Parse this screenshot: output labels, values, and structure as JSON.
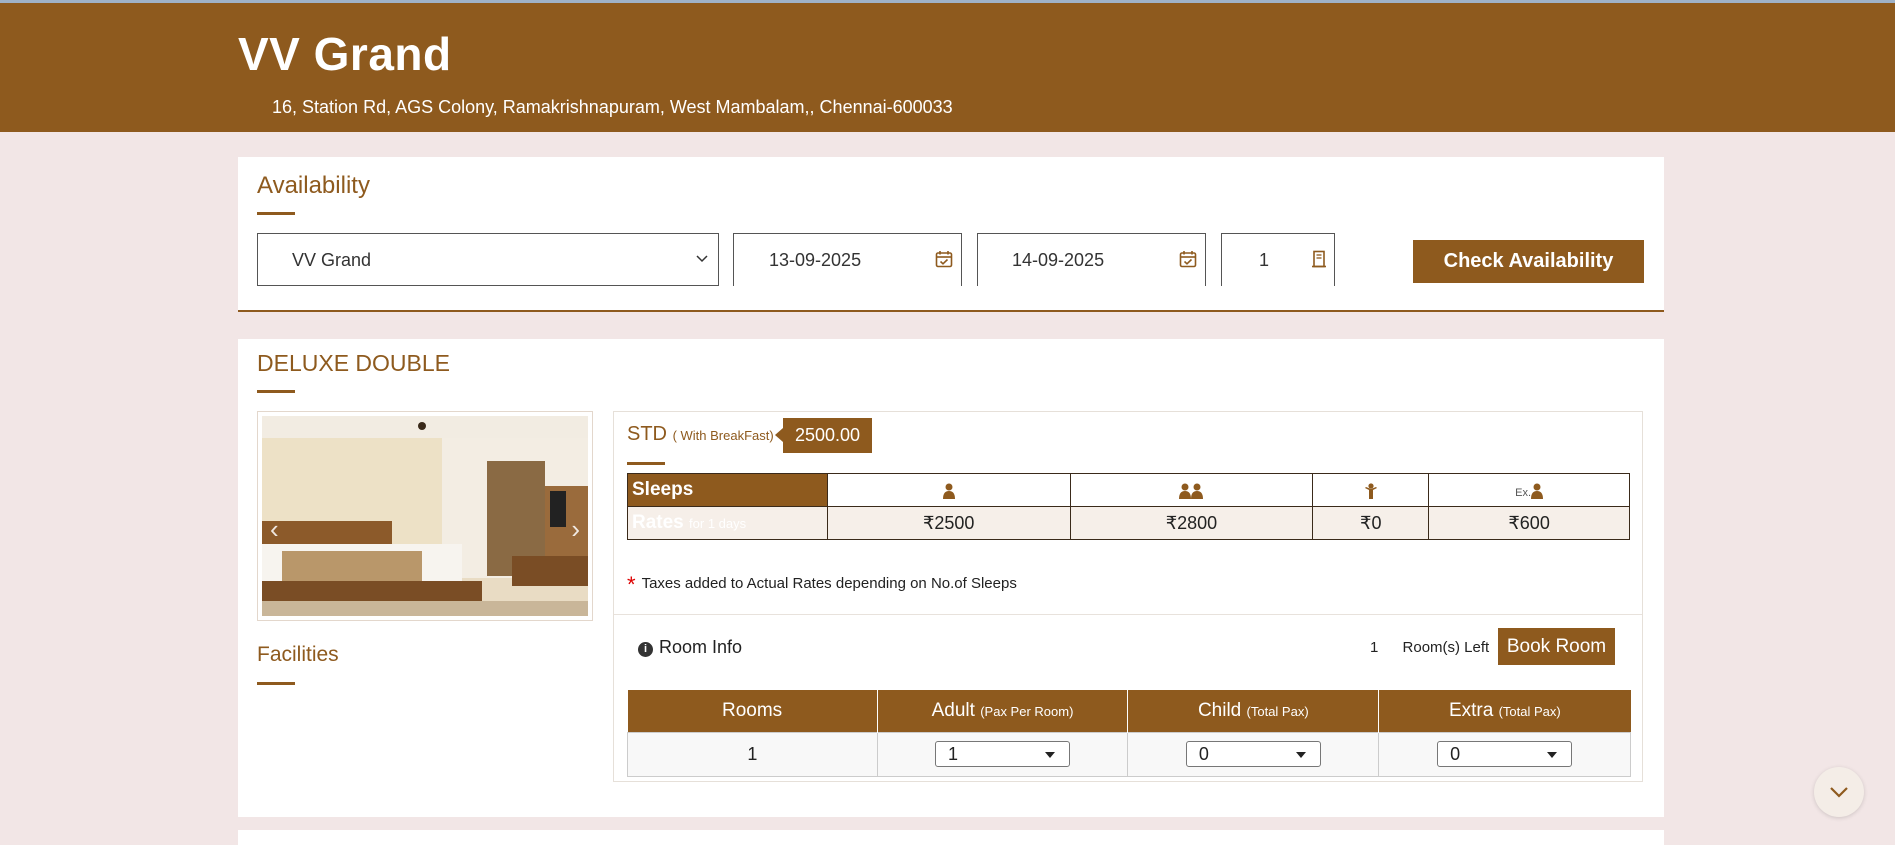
{
  "hotel": {
    "name": "VV Grand",
    "address": "16, Station Rd, AGS Colony, Ramakrishnapuram, West Mambalam,, Chennai-600033"
  },
  "availability": {
    "title": "Availability",
    "hotel_select": "VV Grand",
    "checkin_date": "13-09-2025",
    "checkout_date": "14-09-2025",
    "rooms_count": "1",
    "check_button": "Check Availability"
  },
  "room": {
    "title": "DELUXE DOUBLE",
    "facilities_label": "Facilities",
    "plan": "STD",
    "plan_sub": "( With BreakFast)",
    "price": "2500.00",
    "sleeps_label": "Sleeps",
    "rates_label": "Rates",
    "rates_sub": "for 1 days",
    "extra_prefix": "Ex.",
    "rates": [
      "₹2500",
      "₹2800",
      "₹0",
      "₹600"
    ],
    "tax_note": "Taxes added to Actual Rates depending on No.of Sleeps",
    "room_info_label": "Room Info",
    "rooms_left_count": "1",
    "rooms_left_label": "Room(s) Left",
    "book_button": "Book Room",
    "pax_headers": [
      {
        "label": "Rooms",
        "sub": ""
      },
      {
        "label": "Adult",
        "sub": "(Pax Per Room)"
      },
      {
        "label": "Child",
        "sub": "(Total Pax)"
      },
      {
        "label": "Extra",
        "sub": "(Total Pax)"
      }
    ],
    "pax_row": {
      "rooms": "1",
      "adult": "1",
      "child": "0",
      "extra": "0"
    }
  },
  "icons": {
    "calendar": "calendar-check-icon",
    "room": "door-icon",
    "single": "person-icon",
    "double": "two-persons-icon",
    "child": "child-icon",
    "extra": "extra-person-icon",
    "info": "info-icon",
    "scroll": "chevron-down-icon"
  },
  "colors": {
    "brand": "#8e5a1e",
    "page_bg": "#f2e6e6",
    "tax_star": "#dd0000"
  }
}
